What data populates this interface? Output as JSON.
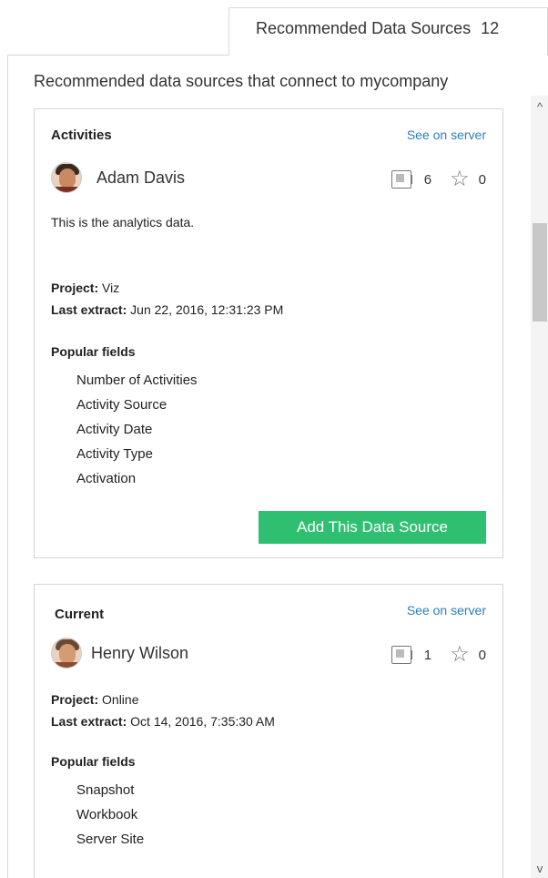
{
  "tab": {
    "label": "Recommended Data Sources",
    "count": "12"
  },
  "panel": {
    "heading": "Recommended data sources that connect to mycompany"
  },
  "scrollbar": {
    "up_glyph": "^",
    "down_glyph": "v"
  },
  "cards": [
    {
      "title": "Activities",
      "see_server": "See on server",
      "owner": "Adam Davis",
      "avatar_colors": {
        "hair": "#3a2a1e",
        "face": "#c98a62",
        "shirt": "#7a2f24"
      },
      "connections": "6",
      "favorites": "0",
      "description": "This is the analytics data.",
      "project_label": "Project:",
      "project": "Viz",
      "extract_label": "Last extract:",
      "extract": "Jun 22, 2016, 12:31:23 PM",
      "popular_label": "Popular fields",
      "fields": [
        "Number of Activities",
        "Activity Source",
        "Activity Date",
        "Activity Type",
        "Activation"
      ],
      "add_button": "Add This Data Source"
    },
    {
      "title": "Current",
      "see_server": "See on server",
      "owner": "Henry Wilson",
      "avatar_colors": {
        "hair": "#6b4a34",
        "face": "#d49b74",
        "shirt": "#8c4a2e"
      },
      "connections": "1",
      "favorites": "0",
      "project_label": "Project:",
      "project": "Online",
      "extract_label": "Last extract:",
      "extract": "Oct 14, 2016, 7:35:30 AM",
      "popular_label": "Popular fields",
      "fields": [
        "Snapshot",
        "Workbook",
        "Server Site"
      ]
    }
  ],
  "colors": {
    "accent_button": "#2fbf71",
    "link": "#2a7fb8"
  }
}
